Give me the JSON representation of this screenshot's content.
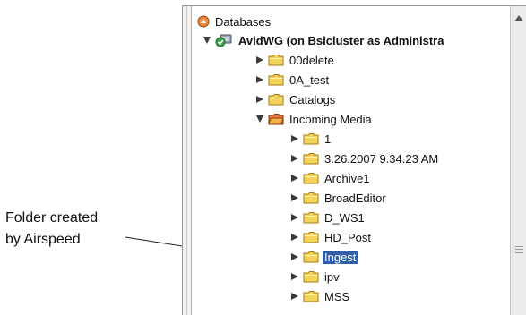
{
  "callout": {
    "line1": "Folder created",
    "line2": "by Airspeed"
  },
  "tree": {
    "root": {
      "label": "Databases",
      "icon": "database-icon"
    },
    "workgroup": {
      "label": "AvidWG (on Bsicluster as Administra",
      "icon": "workgroup-check-icon"
    },
    "folders": [
      {
        "label": "00delete"
      },
      {
        "label": "0A_test"
      },
      {
        "label": "Catalogs"
      },
      {
        "label": "Incoming Media"
      },
      {
        "label": "1"
      },
      {
        "label": "3.26.2007 9.34.23 AM"
      },
      {
        "label": "Archive1"
      },
      {
        "label": "BroadEditor"
      },
      {
        "label": "D_WS1"
      },
      {
        "label": "HD_Post"
      },
      {
        "label": "Ingest"
      },
      {
        "label": "ipv"
      },
      {
        "label": "MSS"
      }
    ]
  },
  "colors": {
    "selection": "#2f5fa8",
    "folder": "#f4d35a",
    "folder_open": "#e87a3a"
  }
}
